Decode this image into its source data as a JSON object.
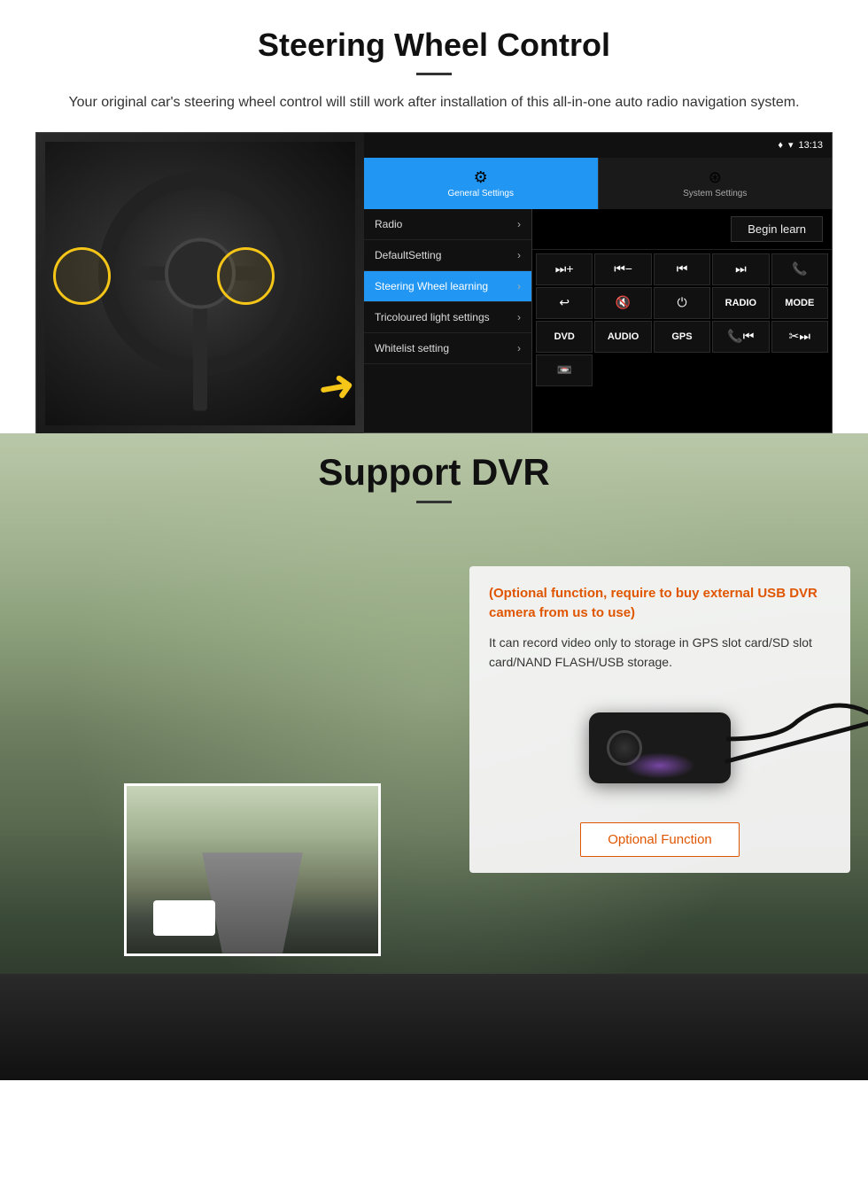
{
  "steering": {
    "title": "Steering Wheel Control",
    "subtitle": "Your original car's steering wheel control will still work after installation of this all-in-one auto radio navigation system.",
    "android": {
      "statusbar": {
        "signal": "▲▼",
        "wifi": "▾",
        "time": "13:13"
      },
      "tab_general": "General Settings",
      "tab_system": "System Settings",
      "menu": [
        {
          "label": "Radio",
          "active": false
        },
        {
          "label": "DefaultSetting",
          "active": false
        },
        {
          "label": "Steering Wheel learning",
          "active": true
        },
        {
          "label": "Tricoloured light settings",
          "active": false
        },
        {
          "label": "Whitelist setting",
          "active": false
        }
      ],
      "begin_learn": "Begin learn",
      "controls": [
        {
          "symbol": "⏮+",
          "type": "icon"
        },
        {
          "symbol": "⏮−",
          "type": "icon"
        },
        {
          "symbol": "⏮",
          "type": "icon"
        },
        {
          "symbol": "⏭",
          "type": "icon"
        },
        {
          "symbol": "📞",
          "type": "icon"
        },
        {
          "symbol": "↩",
          "type": "icon"
        },
        {
          "symbol": "🔇×",
          "type": "icon"
        },
        {
          "symbol": "⏻",
          "type": "icon"
        },
        {
          "symbol": "RADIO",
          "type": "text"
        },
        {
          "symbol": "MODE",
          "type": "text"
        },
        {
          "symbol": "DVD",
          "type": "text"
        },
        {
          "symbol": "AUDIO",
          "type": "text"
        },
        {
          "symbol": "GPS",
          "type": "text"
        },
        {
          "symbol": "☎⏮",
          "type": "icon"
        },
        {
          "symbol": "✂⏭",
          "type": "icon"
        },
        {
          "symbol": "📼",
          "type": "icon"
        }
      ]
    }
  },
  "dvr": {
    "title": "Support DVR",
    "card": {
      "orange_text": "(Optional function, require to buy external USB DVR camera from us to use)",
      "body_text": "It can record video only to storage in GPS slot card/SD slot card/NAND FLASH/USB storage.",
      "button_label": "Optional Function"
    }
  }
}
